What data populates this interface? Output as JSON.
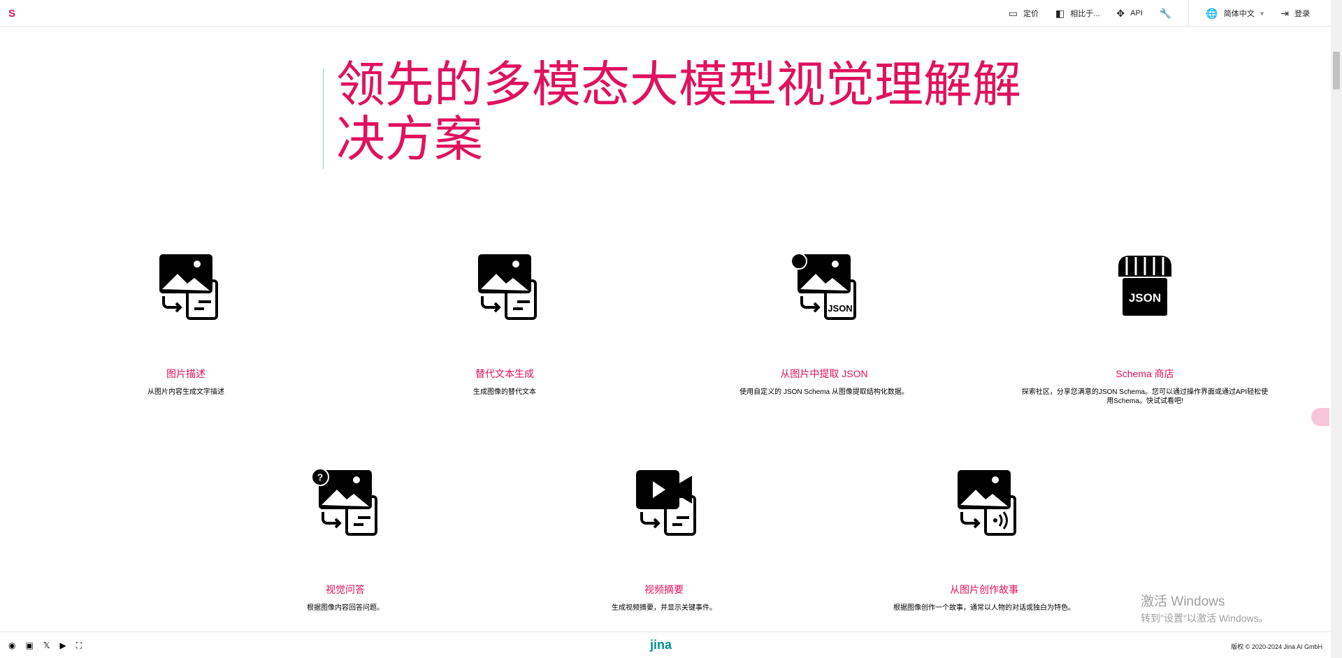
{
  "nav": {
    "pricing": "定价",
    "compare": "相比于...",
    "api": "API",
    "language": "简体中文",
    "login": "登录"
  },
  "hero": {
    "title": "领先的多模态大模型视觉理解解决方案"
  },
  "cards": [
    {
      "title": "图片描述",
      "desc": "从图片内容生成文字描述"
    },
    {
      "title": "替代文本生成",
      "desc": "生成图像的替代文本"
    },
    {
      "title": "从图片中提取 JSON",
      "desc": "使用自定义的 JSON Schema 从图像提取结构化数据。"
    },
    {
      "title": "Schema 商店",
      "desc": "探索社区，分享您满意的JSON Schema。您可以通过操作界面或通过API轻松使用Schema。快试试看吧!"
    },
    {
      "title": "视觉问答",
      "desc": "根据图像内容回答问题。"
    },
    {
      "title": "视频摘要",
      "desc": "生成视频摘要，并显示关键事件。"
    },
    {
      "title": "从图片创作故事",
      "desc": "根据图像创作一个故事，通常以人物的对话或独白为特色。"
    }
  ],
  "footer": {
    "logo": "jina",
    "copyright": "版权 © 2020-2024 Jina AI GmbH"
  },
  "watermark": {
    "line1": "激活 Windows",
    "line2": "转到\"设置\"以激活 Windows。"
  },
  "accent": "#e0115f"
}
